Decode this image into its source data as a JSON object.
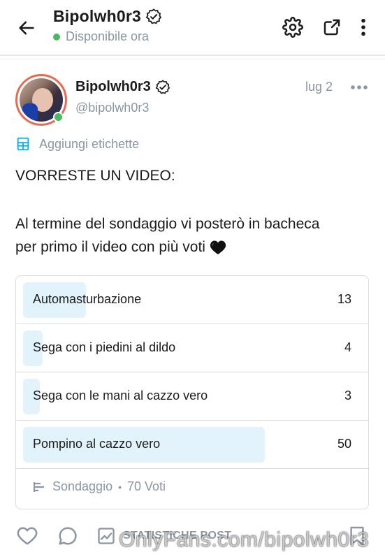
{
  "header": {
    "title": "Bipolwh0r3",
    "status": "Disponibile ora",
    "icons": [
      "back-arrow-icon",
      "verified-badge-icon",
      "gear-icon",
      "share-icon",
      "more-vertical-icon"
    ]
  },
  "post": {
    "author_name": "Bipolwh0r3",
    "author_handle": "@bipolwh0r3",
    "date": "lug 2",
    "tags_label": "Aggiungi etichette",
    "text_line1": "VORRESTE UN VIDEO:",
    "text_line2": "Al termine del sondaggio vi posterò in bacheca",
    "text_line3": "per primo il video con più voti",
    "emoji": "black-heart"
  },
  "poll": {
    "options": [
      {
        "label": "Automasturbazione",
        "votes": "13",
        "fraction": 0.186
      },
      {
        "label": "Sega con i piedini al dildo",
        "votes": "4",
        "fraction": 0.057
      },
      {
        "label": "Sega con le mani al cazzo vero",
        "votes": "3",
        "fraction": 0.043
      },
      {
        "label": "Pompino al cazzo vero",
        "votes": "50",
        "fraction": 0.714
      }
    ],
    "type_label": "Sondaggio",
    "separator": "•",
    "total_votes": "70 Voti"
  },
  "actions": {
    "stats_label": "STATISTICHE POST"
  },
  "watermark": "OnlyFans.com/bipolwh0r3",
  "colors": {
    "accent": "#00aff0",
    "online": "#4cb963",
    "muted_text": "#8a96a3",
    "poll_fill": "#e3f3fb",
    "avatar_ring": "#e86a4f"
  }
}
